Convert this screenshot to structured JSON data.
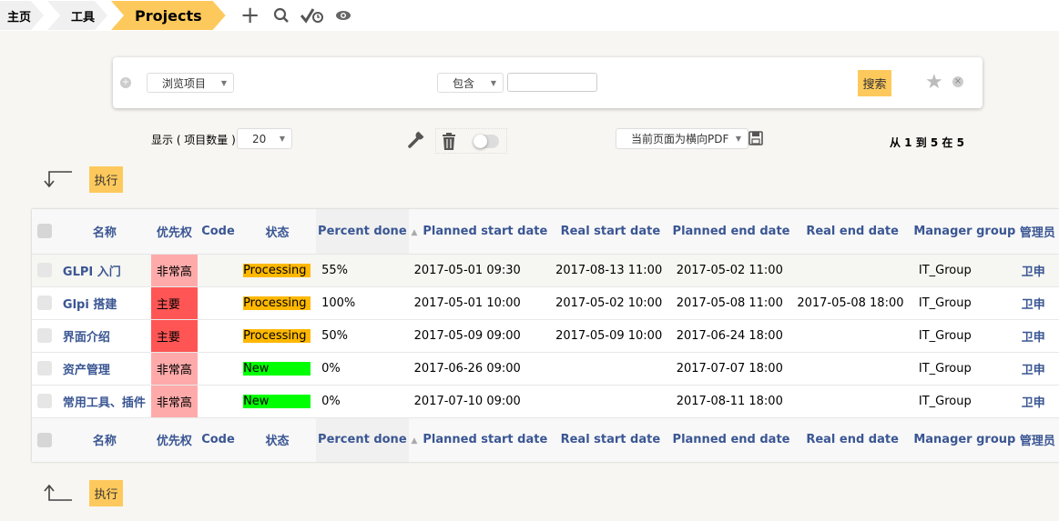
{
  "breadcrumb": [
    {
      "label": "主页"
    },
    {
      "label": "工具"
    },
    {
      "label": "Projects"
    }
  ],
  "toolbar_icons": [
    "plus-icon",
    "search-icon",
    "check-clock-icon",
    "eye-icon"
  ],
  "search": {
    "field": "浏览项目",
    "operator": "包含",
    "value": "",
    "submit": "搜索"
  },
  "controls": {
    "display_label": "显示 ( 项目数量 )",
    "display_count": "20",
    "export": "当前页面为横向PDF",
    "pagination": "从 1 到 5 在 5"
  },
  "action": {
    "label": "执行"
  },
  "colors": {
    "accent": "#fec95c",
    "processing": "#ffb800",
    "new": "#00ff00",
    "priority_very_high": "#ffaaaa",
    "priority_major": "#ff5555",
    "link": "#3a5693"
  },
  "table": {
    "columns": [
      "名称",
      "优先权",
      "Code",
      "状态",
      "Percent done",
      "Planned start date",
      "Real start date",
      "Planned end date",
      "Real end date",
      "Manager group",
      "管理员"
    ],
    "sorted_column": "Planned start date",
    "rows": [
      {
        "name": "GLPI 入门",
        "priority": "非常高",
        "priority_color": "#ffaaaa",
        "code": "",
        "status": "Processing",
        "status_color": "#ffb800",
        "percent": "55%",
        "planned_start": "2017-05-01 09:30",
        "real_start": "2017-08-13 11:00",
        "planned_end": "2017-05-02 11:00",
        "real_end": "",
        "group": "IT_Group",
        "admin": "卫申"
      },
      {
        "name": "Glpi 搭建",
        "priority": "主要",
        "priority_color": "#ff5555",
        "code": "",
        "status": "Processing",
        "status_color": "#ffb800",
        "percent": "100%",
        "planned_start": "2017-05-01 10:00",
        "real_start": "2017-05-02 10:00",
        "planned_end": "2017-05-08 11:00",
        "real_end": "2017-05-08 18:00",
        "group": "IT_Group",
        "admin": "卫申"
      },
      {
        "name": "界面介绍",
        "priority": "主要",
        "priority_color": "#ff5555",
        "code": "",
        "status": "Processing",
        "status_color": "#ffb800",
        "percent": "50%",
        "planned_start": "2017-05-09 09:00",
        "real_start": "2017-05-09 10:00",
        "planned_end": "2017-06-24 18:00",
        "real_end": "",
        "group": "IT_Group",
        "admin": "卫申"
      },
      {
        "name": "资产管理",
        "priority": "非常高",
        "priority_color": "#ffaaaa",
        "code": "",
        "status": "New",
        "status_color": "#00ff00",
        "percent": "0%",
        "planned_start": "2017-06-26 09:00",
        "real_start": "",
        "planned_end": "2017-07-07 18:00",
        "real_end": "",
        "group": "IT_Group",
        "admin": "卫申"
      },
      {
        "name": "常用工具、插件",
        "priority": "非常高",
        "priority_color": "#ffaaaa",
        "code": "",
        "status": "New",
        "status_color": "#00ff00",
        "percent": "0%",
        "planned_start": "2017-07-10 09:00",
        "real_start": "",
        "planned_end": "2017-08-11 18:00",
        "real_end": "",
        "group": "IT_Group",
        "admin": "卫申"
      }
    ]
  }
}
